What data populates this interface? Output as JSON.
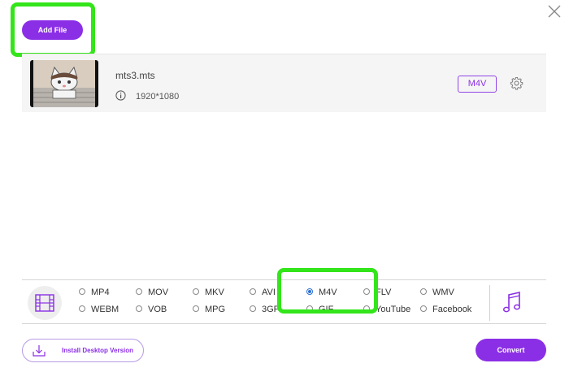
{
  "header": {
    "add_file_label": "Add File"
  },
  "file": {
    "name": "mts3.mts",
    "resolution": "1920*1080",
    "format": "M4V"
  },
  "formats": {
    "video": [
      {
        "label": "MP4",
        "selected": false
      },
      {
        "label": "MOV",
        "selected": false
      },
      {
        "label": "MKV",
        "selected": false
      },
      {
        "label": "AVI",
        "selected": false
      },
      {
        "label": "M4V",
        "selected": true
      },
      {
        "label": "FLV",
        "selected": false
      },
      {
        "label": "WMV",
        "selected": false
      },
      {
        "label": "WEBM",
        "selected": false
      },
      {
        "label": "VOB",
        "selected": false
      },
      {
        "label": "MPG",
        "selected": false
      },
      {
        "label": "3GP",
        "selected": false
      },
      {
        "label": "GIF",
        "selected": false
      },
      {
        "label": "YouTube",
        "selected": false
      },
      {
        "label": "Facebook",
        "selected": false
      }
    ]
  },
  "footer": {
    "install_label": "Install Desktop Version",
    "convert_label": "Convert"
  },
  "colors": {
    "accent": "#8b2fe6",
    "highlight": "#33e51a",
    "selected_radio": "#2a6fd6"
  },
  "icons": [
    "close-icon",
    "info-icon",
    "settings-icon",
    "film-icon",
    "music-note-icon",
    "download-icon"
  ]
}
